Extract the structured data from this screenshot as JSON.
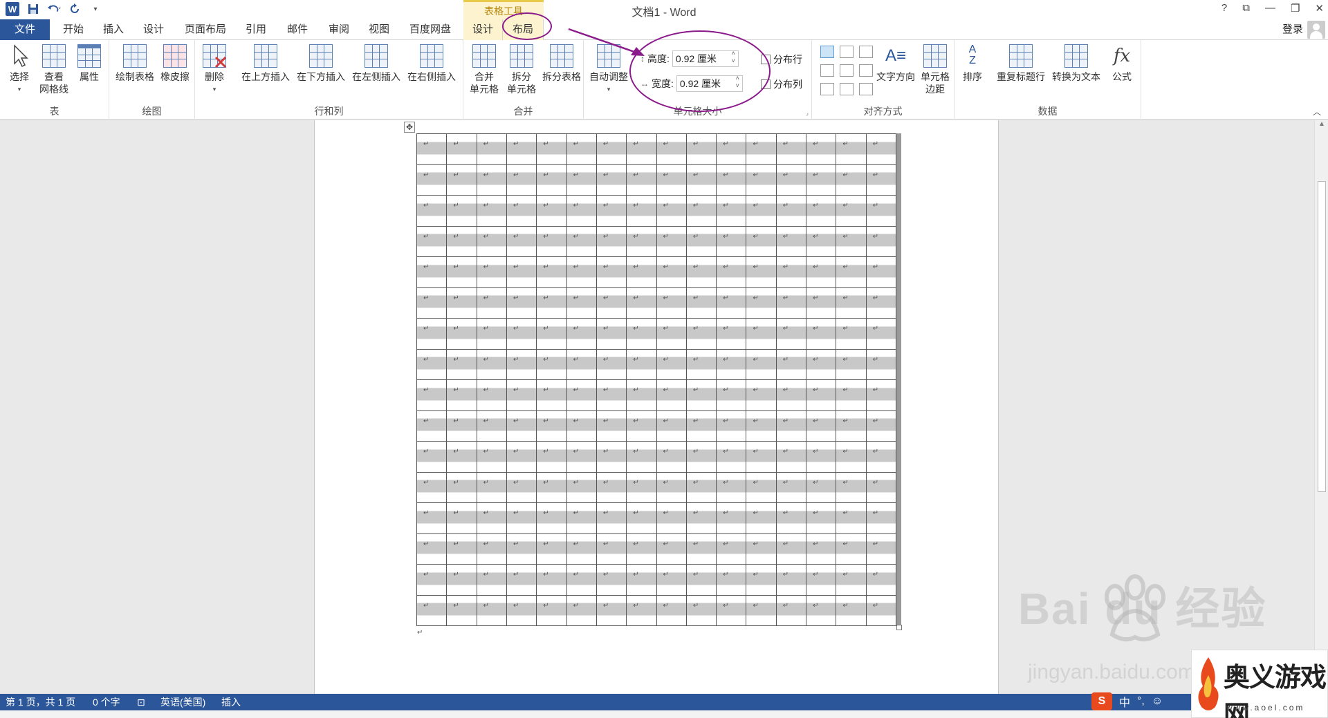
{
  "window": {
    "title": "文档1 - Word",
    "context_tool": "表格工具",
    "controls": [
      "?",
      "⧉",
      "—",
      "❐",
      "✕"
    ]
  },
  "tabs": [
    {
      "label": "文件",
      "kind": "file"
    },
    {
      "label": "开始"
    },
    {
      "label": "插入"
    },
    {
      "label": "设计"
    },
    {
      "label": "页面布局"
    },
    {
      "label": "引用"
    },
    {
      "label": "邮件"
    },
    {
      "label": "审阅"
    },
    {
      "label": "视图"
    },
    {
      "label": "百度网盘"
    },
    {
      "label": "设计",
      "kind": "context"
    },
    {
      "label": "布局",
      "kind": "context-active"
    }
  ],
  "account": {
    "login": "登录"
  },
  "ribbon": {
    "groups": {
      "table": {
        "label": "表",
        "select": "选择",
        "gridlines_1": "查看",
        "gridlines_2": "网格线",
        "properties": "属性"
      },
      "draw": {
        "label": "绘图",
        "draw_table": "绘制表格",
        "eraser": "橡皮擦"
      },
      "rows_cols": {
        "label": "行和列",
        "delete": "删除",
        "insert_above": "在上方插入",
        "insert_below": "在下方插入",
        "insert_left": "在左侧插入",
        "insert_right": "在右侧插入"
      },
      "merge": {
        "label": "合并",
        "merge_1": "合并",
        "merge_2": "单元格",
        "split_1": "拆分",
        "split_2": "单元格",
        "split_table": "拆分表格"
      },
      "cell_size": {
        "label": "单元格大小",
        "autofit": "自动调整",
        "height_label": "高度:",
        "height_value": "0.92 厘米",
        "width_label": "宽度:",
        "width_value": "0.92 厘米",
        "dist_rows": "分布行",
        "dist_cols": "分布列"
      },
      "alignment": {
        "label": "对齐方式",
        "text_direction": "文字方向",
        "cell_margins_1": "单元格",
        "cell_margins_2": "边距"
      },
      "data": {
        "label": "数据",
        "sort": "排序",
        "repeat_header": "重复标题行",
        "convert_text": "转换为文本",
        "formula": "公式"
      }
    }
  },
  "document": {
    "table": {
      "rows": 16,
      "cols": 16
    },
    "handle_glyph": "✥",
    "paragraph_mark": "↵"
  },
  "status_bar": {
    "page": "第 1 页，共 1 页",
    "words": "0 个字",
    "language": "英语(美国)",
    "mode": "插入"
  },
  "ime": {
    "logo": "S",
    "lang": "中",
    "punct": "°,",
    "emoji": "☺"
  },
  "watermarks": {
    "baidu": "Bai du 经验",
    "baidu_url": "jingyan.baidu.com",
    "aoyi_name": "奥义游戏网",
    "aoyi_url": "www.aoel.com"
  },
  "colors": {
    "accent": "#2b579a",
    "context_tab": "#fdf4cf",
    "annotation": "#8b1a8b"
  }
}
